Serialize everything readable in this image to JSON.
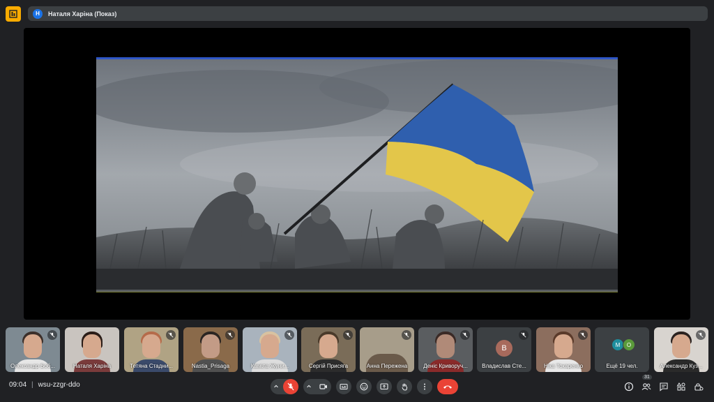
{
  "header": {
    "presenter_initial": "Н",
    "presenter_label": "Наталя Харіна (Показ)"
  },
  "participants": [
    {
      "name": "Олександр Боб...",
      "muted": true
    },
    {
      "name": "Наталя Харіна",
      "muted": false
    },
    {
      "name": "Тетяна Стадни...",
      "muted": true
    },
    {
      "name": "Nastia_Prisaga",
      "muted": true
    },
    {
      "name": "Каміла Жуни...",
      "muted": true
    },
    {
      "name": "Сергій Присяга",
      "muted": true
    },
    {
      "name": "Анна Пережена",
      "muted": true
    },
    {
      "name": "Деніс Криворуч...",
      "muted": true
    },
    {
      "name": "Владислав Сте...",
      "initial": "В",
      "muted": true
    },
    {
      "name": "Ніка Токаренко",
      "muted": true
    },
    {
      "name": "Ещё 19 чел.",
      "initials": [
        "М",
        "О"
      ]
    },
    {
      "name": "Александр Куз...",
      "muted": true
    }
  ],
  "footer": {
    "time": "09:04",
    "meeting_code": "wsu-zzgr-ddo",
    "participant_count": "31"
  },
  "colors": {
    "background": "#202124",
    "tile": "#3c4043",
    "danger": "#ea4335",
    "accent": "#1a73e8",
    "flag_blue": "#2f5fae",
    "flag_yellow": "#e3c64a"
  },
  "icons": {
    "app": "meet-logo-icon",
    "mic": "mic-off-icon",
    "camera": "camera-icon",
    "captions": "captions-icon",
    "emoji": "emoji-icon",
    "present": "present-screen-icon",
    "hand": "raise-hand-icon",
    "more": "more-vert-icon",
    "end": "end-call-icon",
    "info": "info-icon",
    "people": "people-icon",
    "chat": "chat-icon",
    "activities": "activities-icon",
    "lock": "host-controls-icon"
  }
}
